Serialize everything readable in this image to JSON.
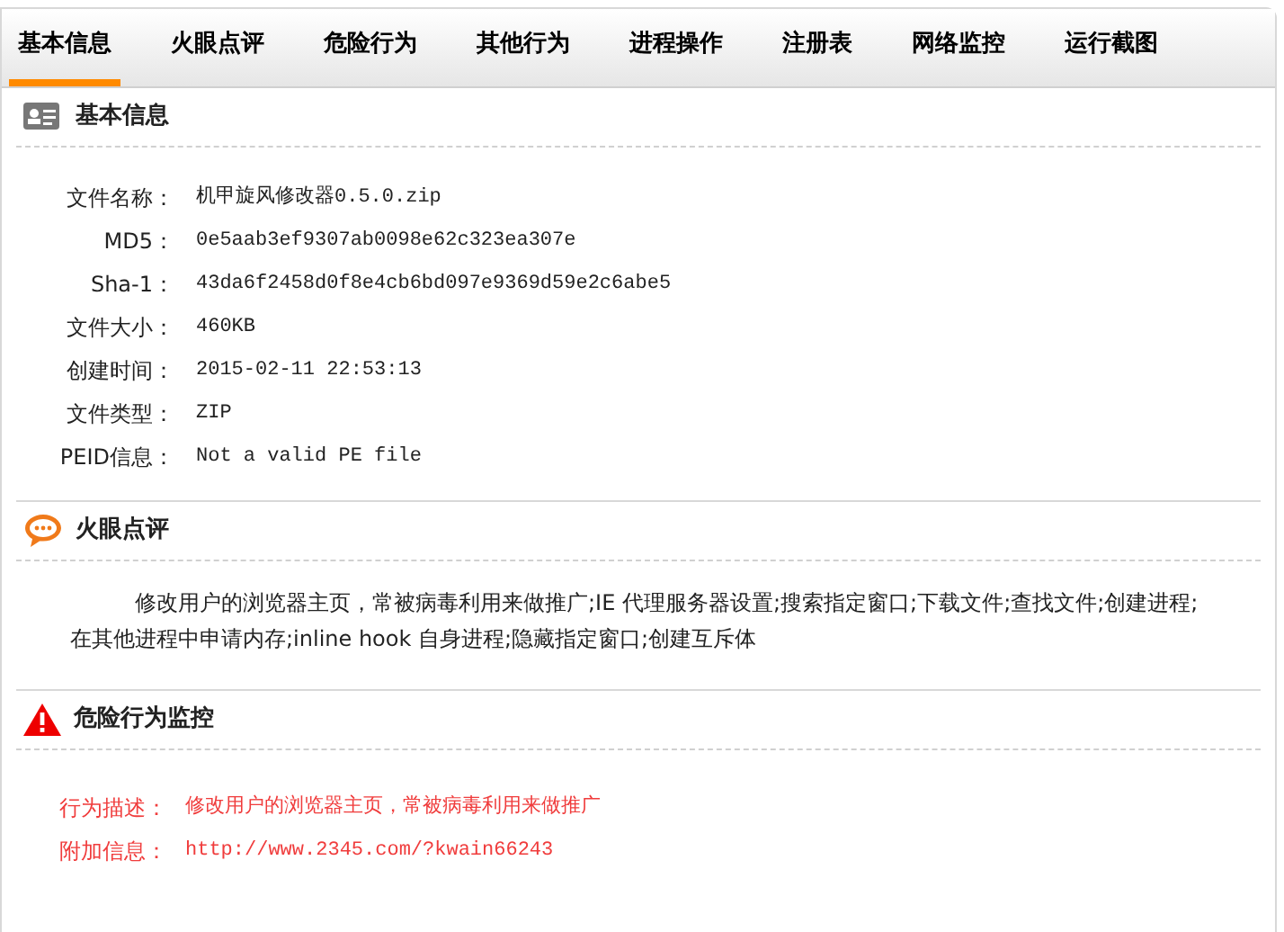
{
  "tabs": [
    {
      "label": "基本信息",
      "selected": true
    },
    {
      "label": "火眼点评",
      "selected": false
    },
    {
      "label": "危险行为",
      "selected": false
    },
    {
      "label": "其他行为",
      "selected": false
    },
    {
      "label": "进程操作",
      "selected": false
    },
    {
      "label": "注册表",
      "selected": false
    },
    {
      "label": "网络监控",
      "selected": false
    },
    {
      "label": "运行截图",
      "selected": false
    }
  ],
  "sections": [
    {
      "kind": "info",
      "title": "基本信息",
      "alert": false,
      "fields": [
        {
          "label": "文件名称：",
          "value": "机甲旋风修改器0.5.0.zip"
        },
        {
          "label": "MD5：",
          "value": "0e5aab3ef9307ab0098e62c323ea307e"
        },
        {
          "label": "Sha-1：",
          "value": "43da6f2458d0f8e4cb6bd097e9369d59e2c6abe5"
        },
        {
          "label": "文件大小：",
          "value": "460KB"
        },
        {
          "label": "创建时间：",
          "value": "2015-02-11 22:53:13"
        },
        {
          "label": "文件类型：",
          "value": "ZIP"
        },
        {
          "label": "PEID信息：",
          "value": "Not a valid PE file"
        }
      ]
    },
    {
      "kind": "comment",
      "title": "火眼点评",
      "alert": false,
      "paragraph": "修改用户的浏览器主页，常被病毒利用来做推广;IE 代理服务器设置;搜索指定窗口;下载文件;查找文件;创建进程;在其他进程中申请内存;inline hook 自身进程;隐藏指定窗口;创建互斥体"
    },
    {
      "kind": "warning",
      "title": "危险行为监控",
      "alert": true,
      "fields": [
        {
          "label": "行为描述：",
          "value": "修改用户的浏览器主页，常被病毒利用来做推广"
        },
        {
          "label": "附加信息：",
          "value": "http://www.2345.com/?kwain66243"
        }
      ]
    }
  ]
}
